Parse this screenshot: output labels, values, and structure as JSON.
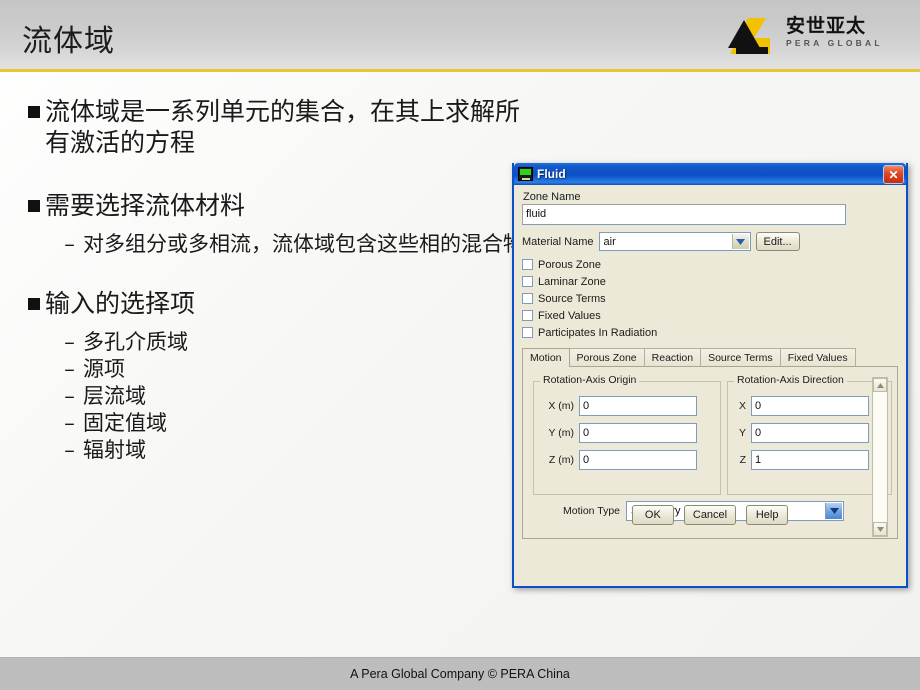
{
  "slide": {
    "title": "流体域",
    "accent_color": "#e8c832",
    "background_color": "#f5f5f3"
  },
  "logo": {
    "chinese": "安世亚太",
    "english": "PERA GLOBAL",
    "mark_color_dark": "#111111",
    "mark_color_accent": "#f2c200"
  },
  "bullets": [
    {
      "level": 1,
      "text": "流体域是一系列单元的集合，在其上求解所有激活的方程"
    },
    {
      "level": 1,
      "text": "需要选择流体材料"
    },
    {
      "level": 2,
      "text": "对多组分或多相流，流体域包含这些相的混合物"
    },
    {
      "level": 1,
      "text": "输入的选择项"
    },
    {
      "level": 2,
      "text": "多孔介质域"
    },
    {
      "level": 2,
      "text": "源项"
    },
    {
      "level": 2,
      "text": "层流域"
    },
    {
      "level": 2,
      "text": "固定值域"
    },
    {
      "level": 2,
      "text": "辐射域"
    }
  ],
  "dialog": {
    "title": "Fluid",
    "title_icon": "fluent-zone-icon",
    "close_icon": "close-icon",
    "titlebar_color": "#0b4fc4",
    "body_color": "#ece9d8",
    "zone_name": {
      "label": "Zone Name",
      "value": "fluid",
      "placeholder": ""
    },
    "material": {
      "label": "Material Name",
      "value": "air",
      "edit_button": "Edit...",
      "dropdown_icon": "chevron-down-icon"
    },
    "checkboxes": [
      {
        "label": "Porous Zone",
        "checked": false
      },
      {
        "label": "Laminar Zone",
        "checked": false
      },
      {
        "label": "Source Terms",
        "checked": false
      },
      {
        "label": "Fixed Values",
        "checked": false
      },
      {
        "label": "Participates In Radiation",
        "checked": false
      }
    ],
    "tabs": [
      {
        "label": "Motion",
        "active": true
      },
      {
        "label": "Porous Zone",
        "active": false
      },
      {
        "label": "Reaction",
        "active": false
      },
      {
        "label": "Source Terms",
        "active": false
      },
      {
        "label": "Fixed Values",
        "active": false
      }
    ],
    "motion_tab": {
      "origin_group": {
        "title": "Rotation-Axis Origin",
        "fields": [
          {
            "axis": "X (m)",
            "value": "0"
          },
          {
            "axis": "Y (m)",
            "value": "0"
          },
          {
            "axis": "Z (m)",
            "value": "0"
          }
        ]
      },
      "direction_group": {
        "title": "Rotation-Axis Direction",
        "fields": [
          {
            "axis": "X",
            "value": "0"
          },
          {
            "axis": "Y",
            "value": "0"
          },
          {
            "axis": "Z",
            "value": "1"
          }
        ]
      },
      "motion_type": {
        "label": "Motion Type",
        "value": "Stationary",
        "dropdown_icon": "chevron-down-icon"
      },
      "scrollbar": {
        "up_icon": "chevron-up-icon",
        "down_icon": "chevron-down-icon"
      }
    },
    "buttons": [
      {
        "label": "OK"
      },
      {
        "label": "Cancel"
      },
      {
        "label": "Help"
      }
    ]
  },
  "footer": {
    "text": "A Pera Global Company ©  PERA China"
  }
}
